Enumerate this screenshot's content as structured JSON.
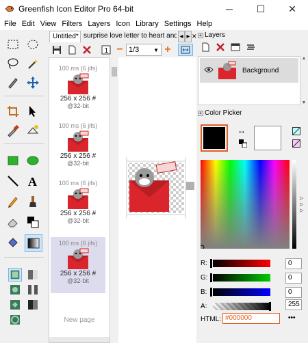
{
  "window": {
    "title": "Greenfish Icon Editor Pro 64-bit",
    "minimize": "─",
    "maximize": "☐",
    "close": "✕"
  },
  "menu": [
    "File",
    "Edit",
    "View",
    "Filters",
    "Layers",
    "Icon",
    "Library",
    "Settings",
    "Help"
  ],
  "tabs": {
    "active": "Untitled*",
    "other": "surprise love letter to heart and in",
    "prev": "◂",
    "next": "▸",
    "close": "✕"
  },
  "toolbar": {
    "page": "1/3",
    "prev_page_label": "1"
  },
  "frames": [
    {
      "time": "100 ms (6 jifs)",
      "size": "256 x 256 #",
      "bit": "@32-bit"
    },
    {
      "time": "100 ms (6 jifs)",
      "size": "256 x 256 #",
      "bit": "@32-bit"
    },
    {
      "time": "100 ms (6 jifs)",
      "size": "256 x 256 #",
      "bit": "@32-bit"
    },
    {
      "time": "100 ms (6 jifs)",
      "size": "256 x 256 #",
      "bit": "@32-bit"
    }
  ],
  "new_page": "New page",
  "layers": {
    "title": "Layers",
    "item": "Background"
  },
  "color_picker": {
    "title": "Color Picker",
    "r_label": "R:",
    "g_label": "G:",
    "b_label": "B:",
    "a_label": "A:",
    "r": "0",
    "g": "0",
    "b": "0",
    "a": "255",
    "html_label": "HTML:",
    "html": "#000000",
    "more": "•••",
    "primary": "#000000",
    "secondary": "#ffffff"
  }
}
